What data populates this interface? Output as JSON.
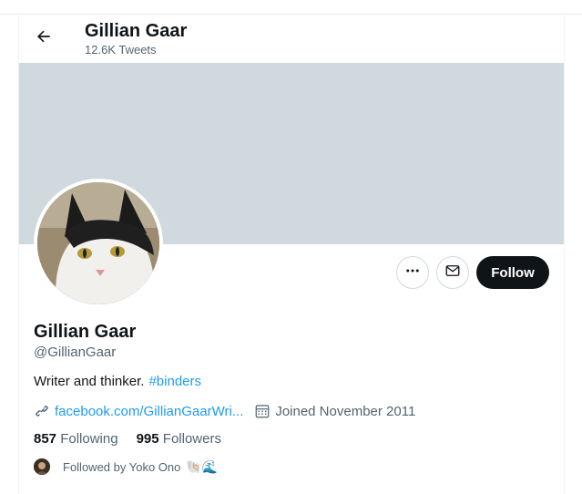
{
  "header": {
    "name": "Gillian Gaar",
    "tweet_count": "12.6K Tweets"
  },
  "profile": {
    "name": "Gillian Gaar",
    "handle": "@GillianGaar",
    "bio_text": "Writer and thinker.",
    "bio_hashtag": "#binders",
    "link": "facebook.com/GillianGaarWri...",
    "joined": "Joined November 2011",
    "following_count": "857",
    "following_label": "Following",
    "followers_count": "995",
    "followers_label": "Followers",
    "followed_by": "Followed by Yoko Ono",
    "followed_by_emoji": "🐚🌊"
  },
  "actions": {
    "follow_label": "Follow"
  },
  "icons": {
    "back": "arrow-left-icon",
    "more": "more-horizontal-icon",
    "message": "envelope-icon",
    "link": "link-icon",
    "calendar": "calendar-icon"
  },
  "colors": {
    "accent": "#1d9bf0",
    "banner": "#cfd9de",
    "follow_button": "#0f1419",
    "secondary_text": "#536471"
  }
}
